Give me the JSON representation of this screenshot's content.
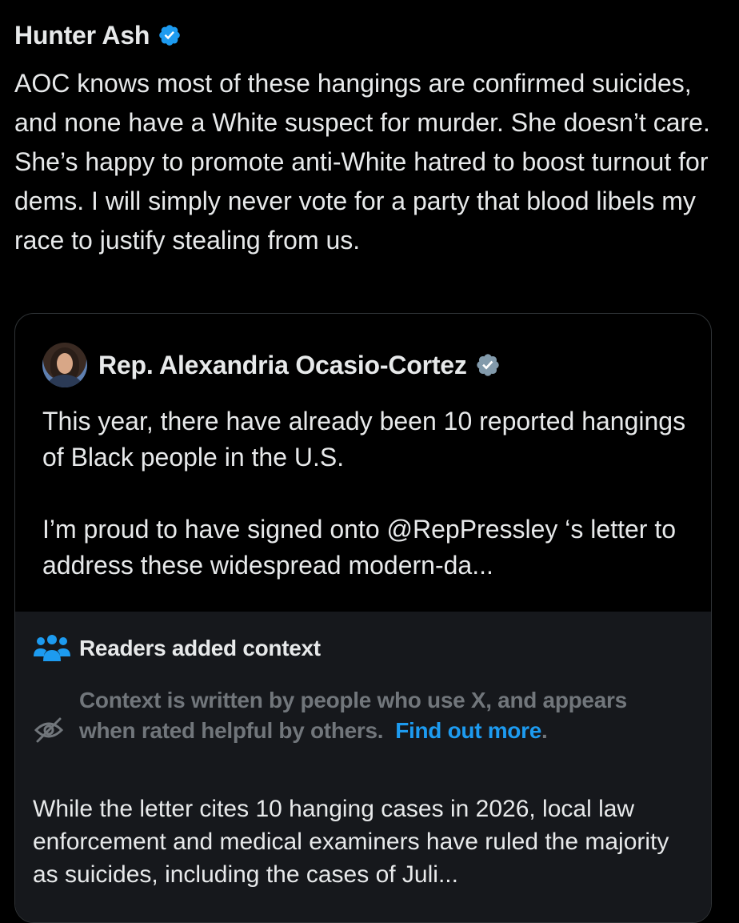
{
  "tweet": {
    "author_name": "Hunter Ash",
    "verified": true,
    "text": "AOC knows most of these hangings are confirmed suicides, and none have a White suspect for murder. She doesn’t care. She’s happy to promote anti-White hatred to boost turnout for dems. I will simply never vote for a party that blood libels my race to justify stealing from us."
  },
  "quote": {
    "author_name": "Rep. Alexandria Ocasio-Cortez",
    "verified": true,
    "text": "This year, there have already been 10 reported hangings of Black people in the U.S.\n\nI’m proud to have signed onto @RepPressley ‘s letter to address these widespread modern-da..."
  },
  "context": {
    "title": "Readers added context",
    "disclaimer": "Context is written by people who use X, and appears when rated helpful by others.",
    "find_out_link": "Find out more",
    "period": ".",
    "note": "While the letter cites 10 hanging cases in 2026, local law enforcement and medical examiners have ruled the majority as suicides, including the cases of Juli..."
  },
  "colors": {
    "background": "#000000",
    "text": "#e7e9ea",
    "muted": "#71767b",
    "accent_blue": "#1d9bf0",
    "verified_blue": "#1d9bf0",
    "verified_gray": "#829aab",
    "panel": "#16181c",
    "border": "#2f3336"
  },
  "icons": {
    "verified": "verified-badge-icon",
    "verified_gray": "verified-gray-badge-icon",
    "readers": "people-group-icon",
    "hidden": "eye-slash-icon"
  }
}
